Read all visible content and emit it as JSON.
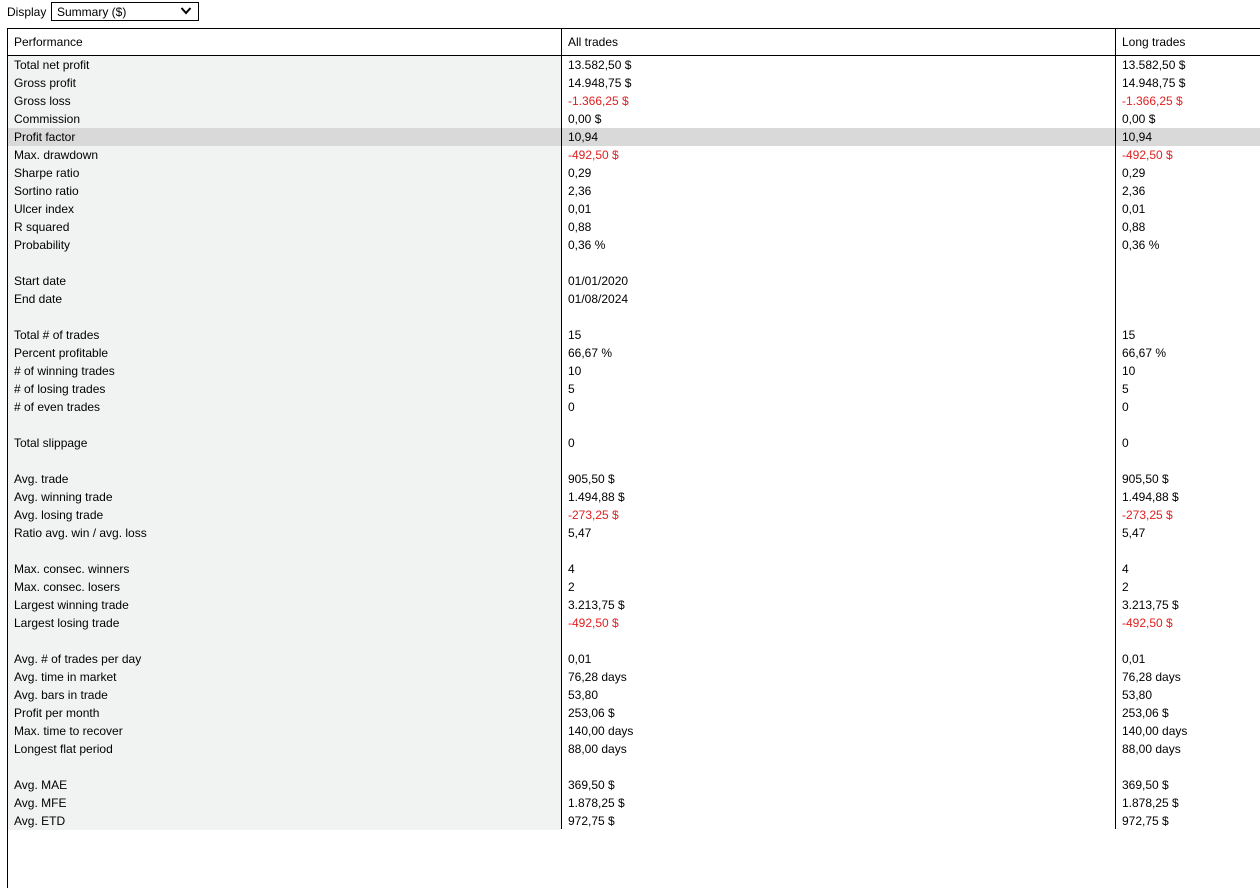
{
  "toolbar": {
    "display_label": "Display",
    "display_value": "Summary ($)"
  },
  "grid": {
    "columns": [
      "Performance",
      "All trades",
      "Long trades"
    ],
    "rows": [
      {
        "label": "Total net profit",
        "all": "13.582,50 $",
        "long": "13.582,50 $"
      },
      {
        "label": "Gross profit",
        "all": "14.948,75 $",
        "long": "14.948,75 $"
      },
      {
        "label": "Gross loss",
        "all": "-1.366,25 $",
        "long": "-1.366,25 $",
        "negative": true
      },
      {
        "label": "Commission",
        "all": "0,00 $",
        "long": "0,00 $"
      },
      {
        "label": "Profit factor",
        "all": "10,94",
        "long": "10,94",
        "highlight": true
      },
      {
        "label": "Max. drawdown",
        "all": "-492,50 $",
        "long": "-492,50 $",
        "negative": true
      },
      {
        "label": "Sharpe ratio",
        "all": "0,29",
        "long": "0,29"
      },
      {
        "label": "Sortino ratio",
        "all": "2,36",
        "long": "2,36"
      },
      {
        "label": "Ulcer index",
        "all": "0,01",
        "long": "0,01"
      },
      {
        "label": "R squared",
        "all": "0,88",
        "long": "0,88"
      },
      {
        "label": "Probability",
        "all": "0,36 %",
        "long": "0,36 %"
      },
      {
        "label": "",
        "all": "",
        "long": ""
      },
      {
        "label": "Start date",
        "all": "01/01/2020",
        "long": ""
      },
      {
        "label": "End date",
        "all": "01/08/2024",
        "long": ""
      },
      {
        "label": "",
        "all": "",
        "long": ""
      },
      {
        "label": "Total # of trades",
        "all": "15",
        "long": "15"
      },
      {
        "label": "Percent profitable",
        "all": "66,67 %",
        "long": "66,67 %"
      },
      {
        "label": "# of winning trades",
        "all": "10",
        "long": "10"
      },
      {
        "label": "# of losing trades",
        "all": "5",
        "long": "5"
      },
      {
        "label": "# of even trades",
        "all": "0",
        "long": "0"
      },
      {
        "label": "",
        "all": "",
        "long": ""
      },
      {
        "label": "Total slippage",
        "all": "0",
        "long": "0"
      },
      {
        "label": "",
        "all": "",
        "long": ""
      },
      {
        "label": "Avg. trade",
        "all": "905,50 $",
        "long": "905,50 $"
      },
      {
        "label": "Avg. winning trade",
        "all": "1.494,88 $",
        "long": "1.494,88 $"
      },
      {
        "label": "Avg. losing trade",
        "all": "-273,25 $",
        "long": "-273,25 $",
        "negative": true
      },
      {
        "label": "Ratio avg. win / avg. loss",
        "all": "5,47",
        "long": "5,47"
      },
      {
        "label": "",
        "all": "",
        "long": ""
      },
      {
        "label": "Max. consec. winners",
        "all": "4",
        "long": "4"
      },
      {
        "label": "Max. consec. losers",
        "all": "2",
        "long": "2"
      },
      {
        "label": "Largest winning trade",
        "all": "3.213,75 $",
        "long": "3.213,75 $"
      },
      {
        "label": "Largest losing trade",
        "all": "-492,50 $",
        "long": "-492,50 $",
        "negative": true
      },
      {
        "label": "",
        "all": "",
        "long": ""
      },
      {
        "label": "Avg. # of trades per day",
        "all": "0,01",
        "long": "0,01"
      },
      {
        "label": "Avg. time in market",
        "all": "76,28 days",
        "long": "76,28 days"
      },
      {
        "label": "Avg. bars in trade",
        "all": "53,80",
        "long": "53,80"
      },
      {
        "label": "Profit per month",
        "all": "253,06 $",
        "long": "253,06 $"
      },
      {
        "label": "Max. time to recover",
        "all": "140,00 days",
        "long": "140,00 days"
      },
      {
        "label": "Longest flat period",
        "all": "88,00 days",
        "long": "88,00 days"
      },
      {
        "label": "",
        "all": "",
        "long": ""
      },
      {
        "label": "Avg. MAE",
        "all": "369,50 $",
        "long": "369,50 $"
      },
      {
        "label": "Avg. MFE",
        "all": "1.878,25 $",
        "long": "1.878,25 $"
      },
      {
        "label": "Avg. ETD",
        "all": "972,75 $",
        "long": "972,75 $"
      }
    ]
  },
  "colors": {
    "negative": "#e02020",
    "label_column_bg": "#f1f2f2",
    "selected_row_bg": "#d9d9d9"
  },
  "icons": {
    "dropdown": "chevron-down-icon"
  }
}
